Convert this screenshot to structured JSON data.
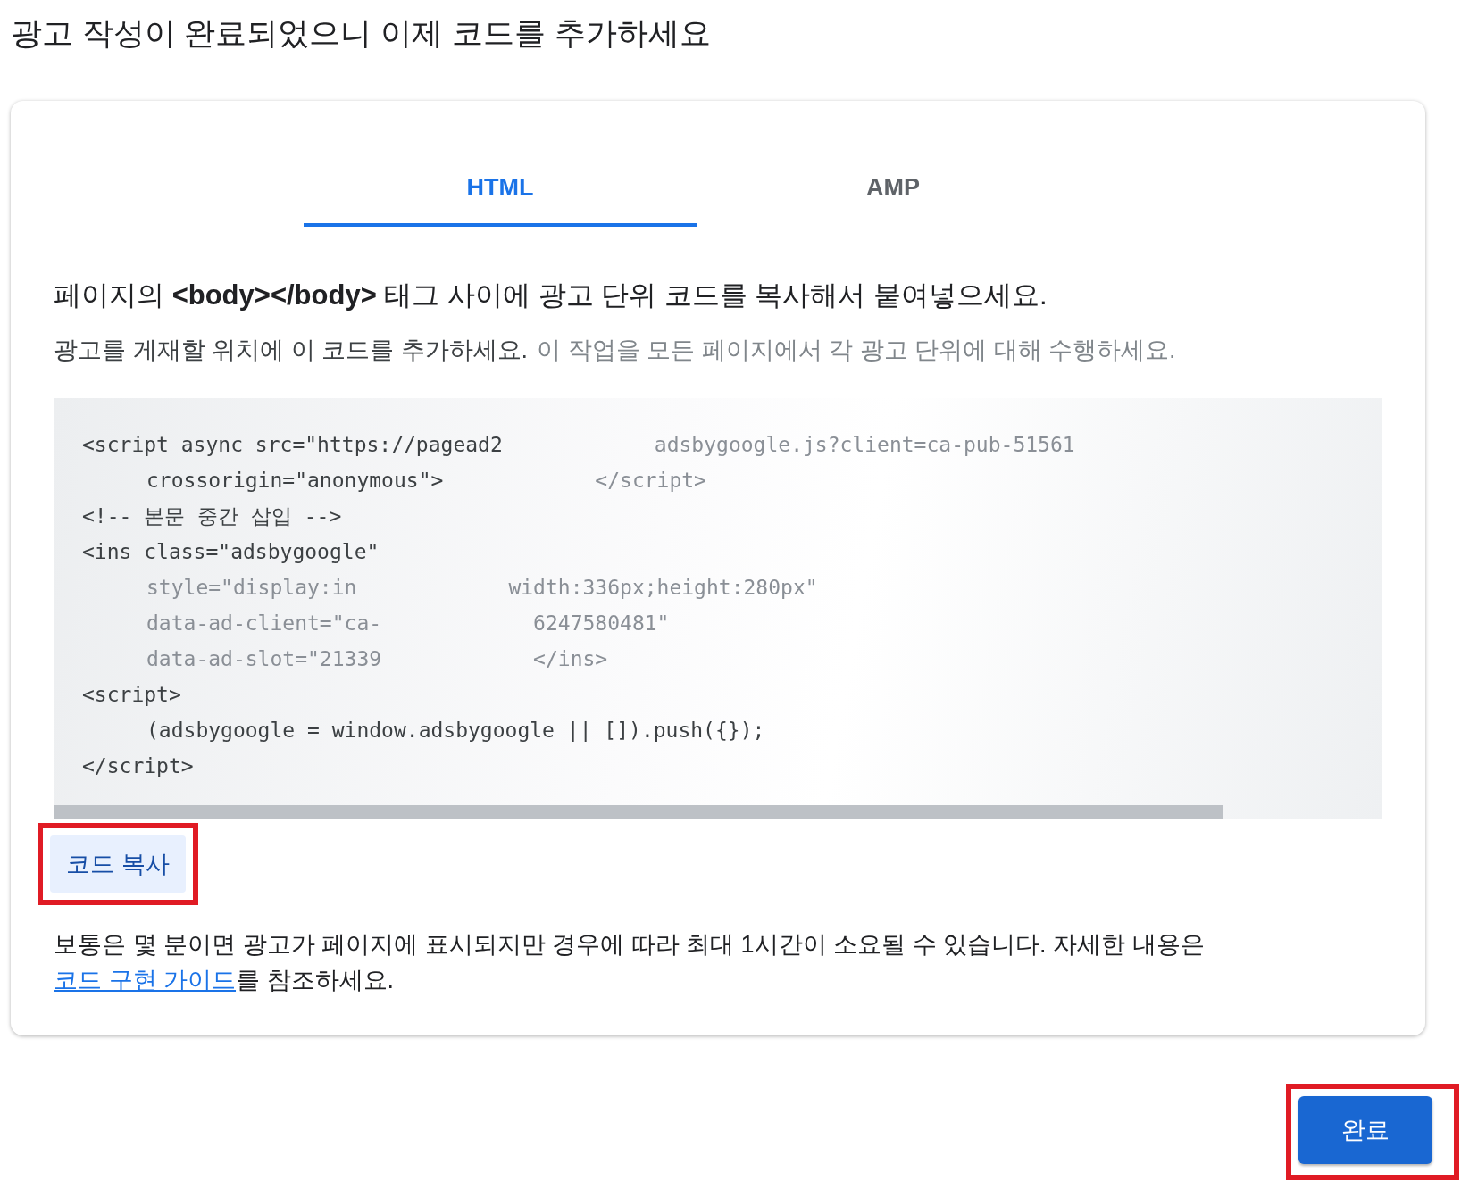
{
  "page_title": "광고 작성이 완료되었으니 이제 코드를 추가하세요",
  "tabs": [
    {
      "label": "HTML",
      "selected": true
    },
    {
      "label": "AMP",
      "selected": false
    }
  ],
  "instruction": {
    "before": "페이지의 ",
    "code": "<body></body>",
    "after": " 태그 사이에 광고 단위 코드를 복사해서 붙여넣으세요."
  },
  "subtext": [
    {
      "text": "광고를 게재할 위치에 이 코드를 추가하세요.",
      "faded": false
    },
    {
      "text": "이 작업을 모든 페이지에서 각 광고 단위에 대해 수행하세요.",
      "faded": true
    }
  ],
  "code_lines": [
    {
      "indent": false,
      "segments": [
        {
          "text": "<script async src=\"https://pagead2",
          "faded": false
        },
        {
          "text": "adsbygoogle.js?client=ca-pub-51561",
          "faded": true
        }
      ]
    },
    {
      "indent": true,
      "segments": [
        {
          "text": "crossorigin=\"anonymous\">",
          "faded": false
        },
        {
          "text": "</script>",
          "faded": true
        }
      ]
    },
    {
      "indent": false,
      "segments": [
        {
          "text": "<!-- 본문 중간 삽입 -->",
          "faded": false
        }
      ]
    },
    {
      "indent": false,
      "segments": [
        {
          "text": "<ins class=\"adsbygoogle\"",
          "faded": false
        }
      ]
    },
    {
      "indent": true,
      "segments": [
        {
          "text": "style=\"display:in",
          "faded": true
        },
        {
          "text": "width:336px;height:280px\"",
          "faded": true
        }
      ]
    },
    {
      "indent": true,
      "segments": [
        {
          "text": "data-ad-client=\"ca-",
          "faded": true
        },
        {
          "text": "6247580481\"",
          "faded": true
        }
      ]
    },
    {
      "indent": true,
      "segments": [
        {
          "text": "data-ad-slot=\"21339",
          "faded": true
        },
        {
          "text": "</ins>",
          "faded": true
        }
      ]
    },
    {
      "indent": false,
      "segments": [
        {
          "text": "<script>",
          "faded": false
        }
      ]
    },
    {
      "indent": true,
      "segments": [
        {
          "text": "(adsbygoogle = window.adsbygoogle || []).push({});",
          "faded": false
        }
      ]
    },
    {
      "indent": false,
      "segments": [
        {
          "text": "</script>",
          "faded": false
        }
      ]
    }
  ],
  "copy_button": {
    "label": "코드 복사",
    "highlighted": true
  },
  "note": {
    "text": "보통은 몇 분이면 광고가 페이지에 표시되지만 경우에 따라 최대 1시간이 소요될 수 있습니다. 자세한 내용은 ",
    "link": "코드 구현 가이드",
    "after": "를 참조하세요."
  },
  "done_button": {
    "label": "완료",
    "highlighted": true
  }
}
